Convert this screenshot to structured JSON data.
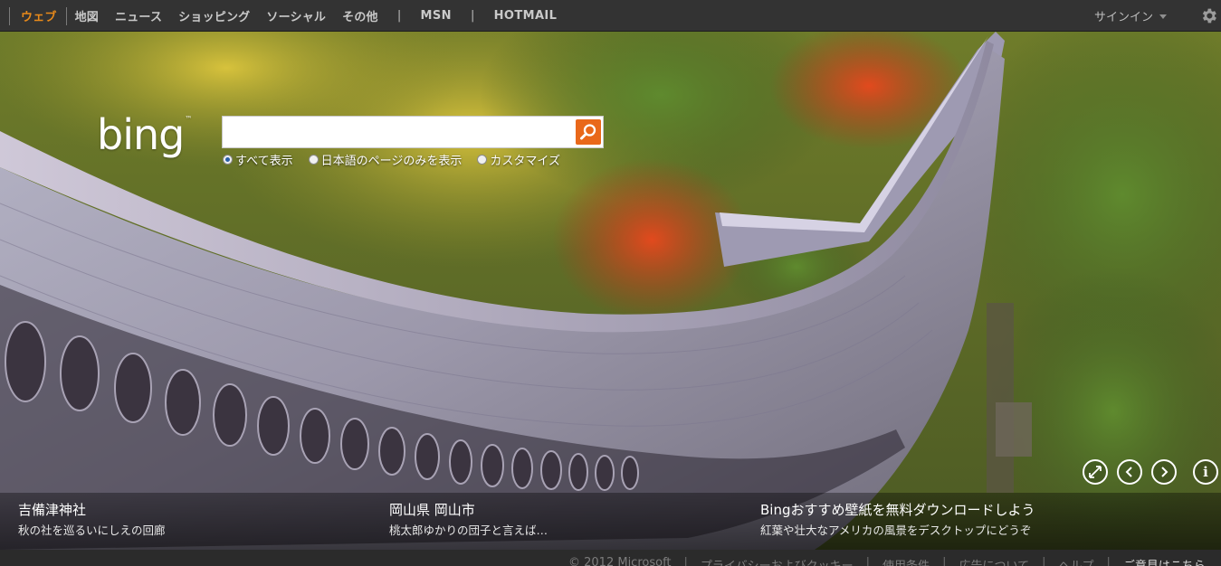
{
  "nav": {
    "items": [
      {
        "label": "ウェブ",
        "active": true
      },
      {
        "label": "地図"
      },
      {
        "label": "ニュース"
      },
      {
        "label": "ショッピング"
      },
      {
        "label": "ソーシャル"
      },
      {
        "label": "その他"
      }
    ],
    "msn": "MSN",
    "hotmail": "HOTMAIL",
    "pipe": "|",
    "signin": "サインイン",
    "accent_color": "#e98a1a"
  },
  "logo": {
    "text": "bing",
    "tm": "™"
  },
  "search": {
    "value": "",
    "placeholder": "",
    "button_color": "#e9681a",
    "scopes": [
      {
        "label": "すべて表示",
        "selected": true
      },
      {
        "label": "日本語のページのみを表示",
        "selected": false
      },
      {
        "label": "カスタマイズ",
        "selected": false
      }
    ]
  },
  "hero": {
    "controls": [
      "expand-icon",
      "chevron-left-icon",
      "chevron-right-icon",
      "info-icon"
    ],
    "info_glyph": "i",
    "captions": [
      {
        "title": "吉備津神社",
        "sub": "秋の社を巡るいにしえの回廊"
      },
      {
        "title": "岡山県 岡山市",
        "sub": "桃太郎ゆかりの団子と言えば…"
      },
      {
        "title": "Bingおすすめ壁紙を無料ダウンロードしよう",
        "sub": "紅葉や壮大なアメリカの風景をデスクトップにどうぞ"
      }
    ]
  },
  "footer": {
    "links": [
      "© 2012 Microsoft",
      "プライバシーおよびクッキー",
      "使用条件",
      "広告について",
      "ヘルプ",
      "ご意見はこちら"
    ],
    "separator": "|"
  }
}
